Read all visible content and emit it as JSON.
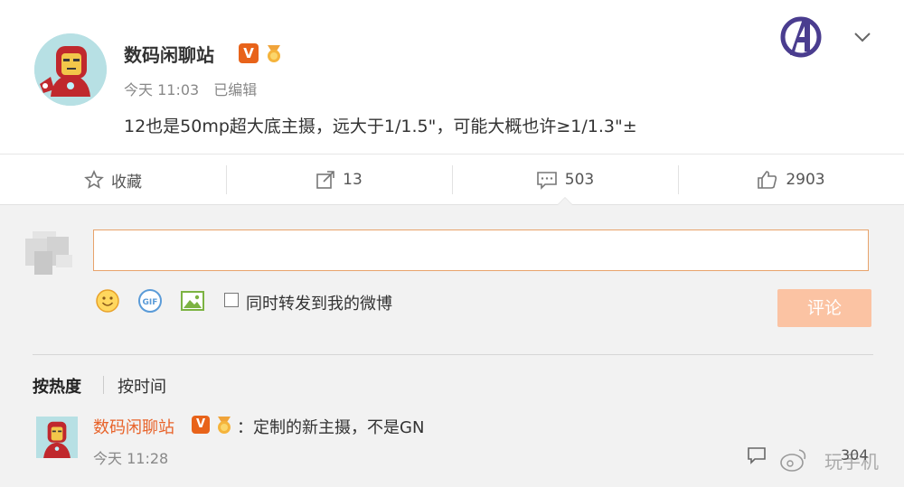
{
  "post": {
    "author": "数码闲聊站",
    "verified_badge": "V",
    "time": "今天 11:03",
    "edited": "已编辑",
    "text": "12也是50mp超大底主摄，远大于1/1.5\"，可能大概也许≥1/1.3\"±"
  },
  "actions": {
    "favorite_label": "收藏",
    "repost_count": "13",
    "comment_count": "503",
    "like_count": "2903"
  },
  "composer": {
    "input_value": "",
    "repost_checkbox_label": "同时转发到我的微博",
    "submit_label": "评论",
    "gif_label": "GIF"
  },
  "sort": {
    "hot": "按热度",
    "time": "按时间"
  },
  "comment": {
    "author": "数码闲聊站",
    "verified_badge": "V",
    "separator": "：",
    "text": "定制的新主摄，不是GN",
    "time": "今天 11:28",
    "likes": "304"
  },
  "watermark": {
    "text": "玩手机"
  },
  "colors": {
    "accent": "#e8631a",
    "submit_disabled": "#fbc3a3",
    "comment_bg": "#f2f2f2",
    "author_link": "#e8632a"
  },
  "icons": [
    "iron-man-avatar",
    "verified-v-icon",
    "medal-icon",
    "avengers-logo-icon",
    "chevron-down-icon",
    "star-icon",
    "share-icon",
    "comment-icon",
    "like-icon",
    "emoji-icon",
    "gif-icon",
    "image-icon",
    "reply-icon"
  ]
}
